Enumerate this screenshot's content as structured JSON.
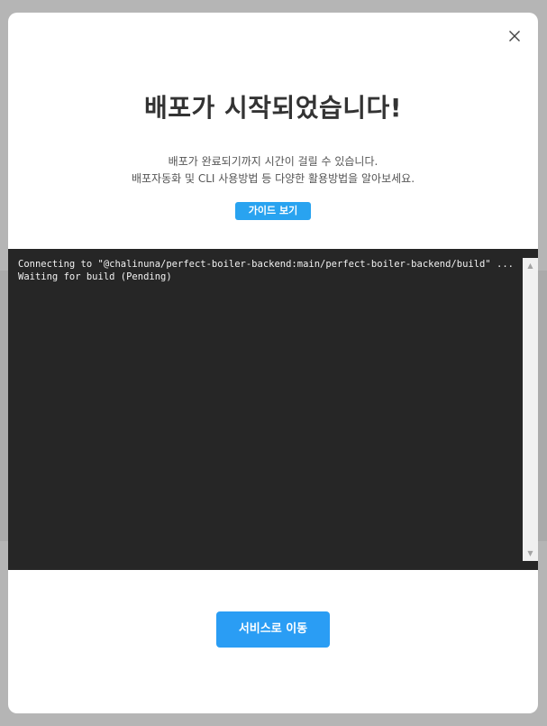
{
  "dialog": {
    "title": "배포가 시작되었습니다!",
    "description_line1": "배포가 완료되기까지 시간이 걸릴 수 있습니다.",
    "description_line2": "배포자동화 및 CLI 사용방법 등 다양한 활용방법을 알아보세요.",
    "guide_button_label": "가이드 보기",
    "primary_button_label": "서비스로 이동",
    "close_icon": "close-icon"
  },
  "terminal": {
    "lines": [
      "Connecting to \"@chalinuna/perfect-boiler-backend:main/perfect-boiler-backend/build\" ...",
      "Waiting for build (Pending)"
    ]
  },
  "colors": {
    "accent": "#2a9df4",
    "terminal_bg": "#262626",
    "overlay": "#b5b5b5",
    "title_text": "#333333"
  }
}
